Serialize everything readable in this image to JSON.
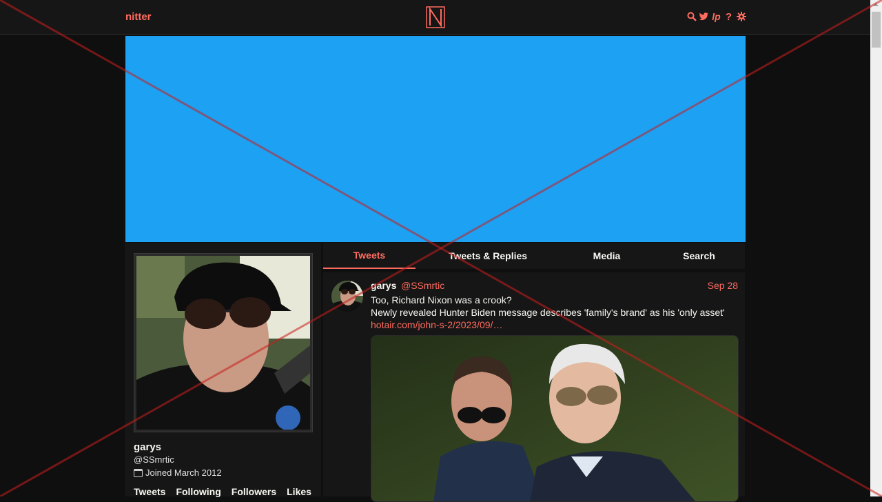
{
  "nav": {
    "brand": "nitter",
    "icons": [
      "search-icon",
      "twitter-bird-icon",
      "rss-icon",
      "help-icon",
      "gear-icon"
    ]
  },
  "profile": {
    "fullname": "garys",
    "username": "@SSmrtic",
    "joined": "Joined March 2012",
    "stats": [
      "Tweets",
      "Following",
      "Followers",
      "Likes"
    ]
  },
  "tabs": [
    {
      "label": "Tweets",
      "active": true
    },
    {
      "label": "Tweets & Replies",
      "active": false
    },
    {
      "label": "Media",
      "active": false
    },
    {
      "label": "Search",
      "active": false
    }
  ],
  "tweet": {
    "fullname": "garys",
    "handle": "@SSmrtic",
    "date": "Sep 28",
    "line1": "Too, Richard Nixon was a crook?",
    "line2": "Newly revealed Hunter Biden message describes 'family's brand' as his 'only asset'",
    "link": "hotair.com/john-s-2/2023/09/…"
  },
  "colors": {
    "accent": "#ff6c60",
    "banner": "#1da1f2",
    "background": "#0f0f0f",
    "panel": "#161616"
  }
}
